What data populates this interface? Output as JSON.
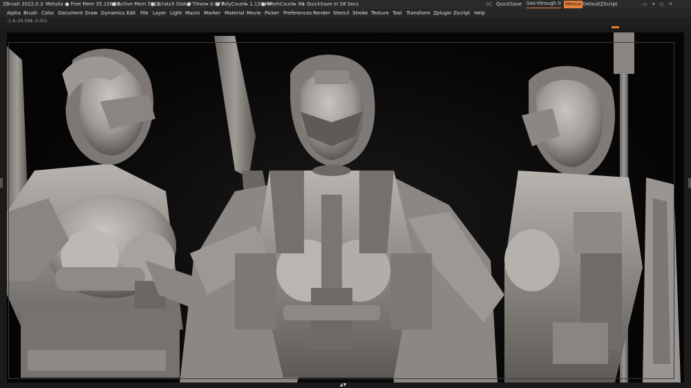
{
  "titlebar": {
    "app": "ZBrush 2022.0.3",
    "user": "Metalia",
    "free_mem": "● Free Mem 35.158GB",
    "active_mem": "● Active Mem 5912",
    "scratch": "● Scratch Disk 0",
    "timer": "● Timer▸ 0.073",
    "polycount": "● PolyCount▸ 1.128 MP",
    "meshcount": "● MeshCount▸ 90",
    "quicksave_timer": "▸ QuickSave In 58 Secs",
    "ac": "AC",
    "quicksave": "QuickSave",
    "see_through": "See-through  0",
    "menus": "Menus",
    "script": "DefaultZScript"
  },
  "menu": [
    "Alpha",
    "Brush",
    "Color",
    "Document",
    "Draw",
    "Dynamics",
    "Edit",
    "File",
    "Layer",
    "Light",
    "Macro",
    "Marker",
    "Material",
    "Movie",
    "Picker",
    "Preferences",
    "Render",
    "Stencil",
    "Stroke",
    "Texture",
    "Tool",
    "Transform",
    "Zplugin",
    "Zscript",
    "Help"
  ],
  "coords": "-1.4,-26.598,-3.352",
  "colors": {
    "accent": "#e8823a",
    "clay": "#a8a39e"
  },
  "bottom_arrows": "▲▼"
}
